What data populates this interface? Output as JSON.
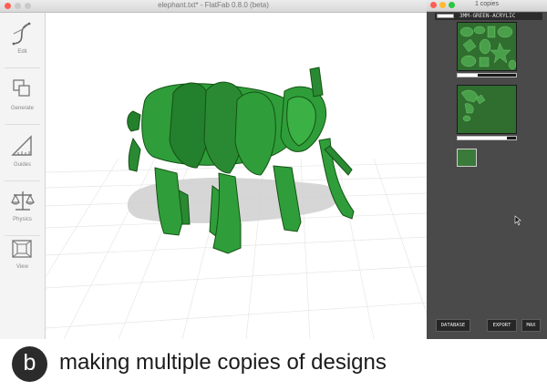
{
  "main_window": {
    "title": "elephant.txt* - FlatFab 0.8.0 (beta)"
  },
  "toolbar": {
    "items": [
      {
        "label": "Edit",
        "icon": "pen-curve-icon"
      },
      {
        "label": "Generate",
        "icon": "layers-icon"
      },
      {
        "label": "Guides",
        "icon": "triangle-ruler-icon"
      },
      {
        "label": "Physics",
        "icon": "balance-scale-icon"
      },
      {
        "label": "View",
        "icon": "perspective-box-icon"
      }
    ]
  },
  "copies_window": {
    "title": "1 copies",
    "material": "3MM-GREEN-ACRYLIC",
    "sheets": [
      {
        "progress": 0.35
      },
      {
        "progress": 0.85
      }
    ],
    "buttons": {
      "database": "DATABASE",
      "export": "EXPORT",
      "max": "MAX"
    }
  },
  "caption": {
    "badge": "b",
    "text": "making multiple copies of designs"
  },
  "colors": {
    "part_green": "#2f9e3a",
    "sheet_green": "#2f6e2f",
    "panel_bg": "#4a4a4a"
  }
}
